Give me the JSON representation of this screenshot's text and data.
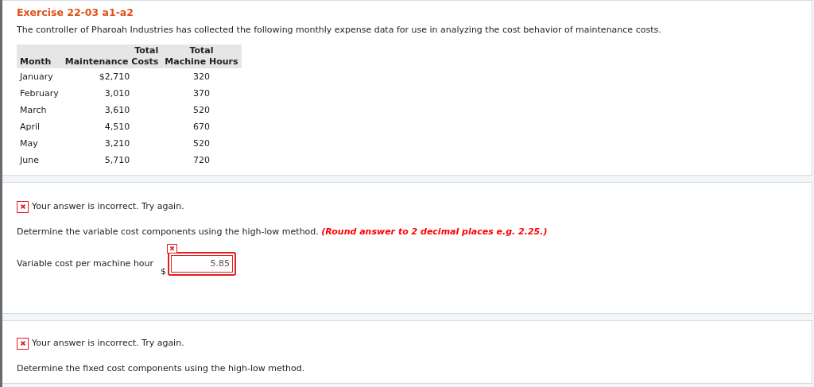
{
  "exercise": {
    "title": "Exercise 22-03 a1-a2",
    "intro": "The controller of Pharoah Industries has collected the following monthly expense data for use in analyzing the cost behavior of maintenance costs.",
    "table": {
      "columns": [
        {
          "lines": [
            "Month"
          ]
        },
        {
          "lines": [
            "Total",
            "Maintenance Costs"
          ]
        },
        {
          "lines": [
            "Total",
            "Machine Hours"
          ]
        }
      ],
      "rows": [
        [
          "January",
          "$2,710",
          "320"
        ],
        [
          "February",
          "3,010",
          "370"
        ],
        [
          "March",
          "3,610",
          "520"
        ],
        [
          "April",
          "4,510",
          "670"
        ],
        [
          "May",
          "3,210",
          "520"
        ],
        [
          "June",
          "5,710",
          "720"
        ]
      ]
    }
  },
  "parts": [
    {
      "feedback": {
        "correct": false,
        "text": "Your answer is incorrect.  Try again."
      },
      "prompt": "Determine the variable cost components using the high-low method.",
      "hint": "(Round answer to 2 decimal places e.g. 2.25.)",
      "fields": [
        {
          "label": "Variable cost per machine hour",
          "currency": "$",
          "value": "5.85",
          "correct": false
        }
      ]
    },
    {
      "feedback": {
        "correct": false,
        "text": "Your answer is incorrect.  Try again."
      },
      "prompt": "Determine the fixed cost components using the high-low method."
    }
  ]
}
